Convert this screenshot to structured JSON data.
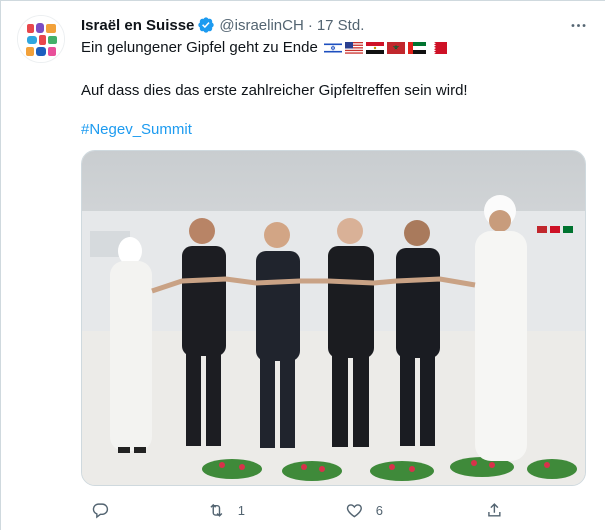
{
  "tweet": {
    "display_name": "Israël en Suisse",
    "handle": "@israelinCH",
    "separator": "·",
    "time": "17 Std.",
    "text_line1": "Ein gelungener Gipfel geht zu Ende",
    "text_line2": "Auf dass dies das erste zahlreicher Gipfeltreffen sein wird!",
    "hashtag": "#Negev_Summit",
    "flags": [
      "israel-flag",
      "usa-flag",
      "egypt-flag",
      "morocco-flag",
      "uae-flag",
      "bahrain-flag"
    ],
    "retweet_count": "1",
    "like_count": "6",
    "reply_count": "",
    "colors": {
      "link": "#1d9bf0",
      "text": "#0f1419",
      "muted": "#536471",
      "border": "#cfd9de"
    },
    "icons": {
      "more": "more-dots-icon",
      "reply": "reply-icon",
      "retweet": "retweet-icon",
      "like": "heart-icon",
      "share": "share-icon",
      "verified": "verified-badge-icon"
    }
  }
}
